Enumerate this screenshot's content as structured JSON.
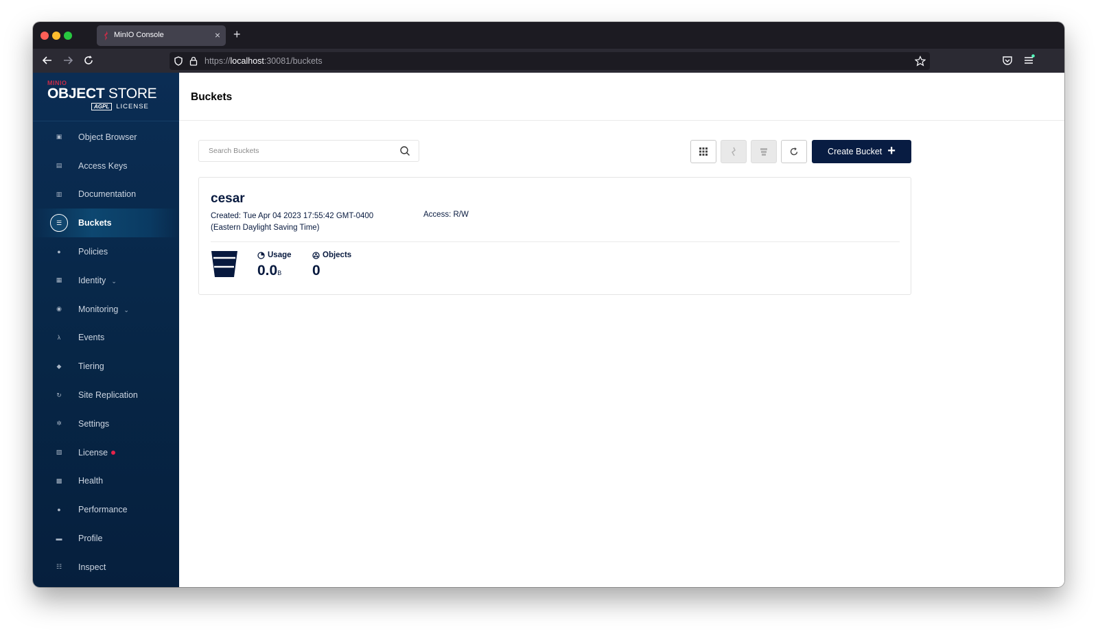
{
  "browser": {
    "tab_title": "MinIO Console",
    "tab_close": "×",
    "new_tab": "+",
    "url_scheme": "https://",
    "url_host": "localhost",
    "url_rest": ":30081/buckets"
  },
  "sidebar": {
    "logo_brand": "MINIO",
    "logo_bold": "OBJECT",
    "logo_light": " STORE",
    "logo_license_badge": "AGPL",
    "logo_license": "LICENSE",
    "items": [
      {
        "label": "Object Browser",
        "icon": "object-browser-icon"
      },
      {
        "label": "Access Keys",
        "icon": "access-keys-icon"
      },
      {
        "label": "Documentation",
        "icon": "documentation-icon"
      },
      {
        "label": "Buckets",
        "icon": "buckets-icon",
        "active": true
      },
      {
        "label": "Policies",
        "icon": "policies-icon"
      },
      {
        "label": "Identity",
        "icon": "identity-icon",
        "expandable": true
      },
      {
        "label": "Monitoring",
        "icon": "monitoring-icon",
        "expandable": true
      },
      {
        "label": "Events",
        "icon": "lambda-icon"
      },
      {
        "label": "Tiering",
        "icon": "tiering-icon"
      },
      {
        "label": "Site Replication",
        "icon": "site-replication-icon"
      },
      {
        "label": "Settings",
        "icon": "settings-icon"
      },
      {
        "label": "License",
        "icon": "license-icon",
        "alert_dot": true
      },
      {
        "label": "Health",
        "icon": "health-icon"
      },
      {
        "label": "Performance",
        "icon": "performance-icon"
      },
      {
        "label": "Profile",
        "icon": "profile-icon"
      },
      {
        "label": "Inspect",
        "icon": "inspect-icon"
      }
    ]
  },
  "main": {
    "title": "Buckets",
    "search_placeholder": "Search Buckets",
    "create_button": "Create Bucket",
    "create_plus": "+",
    "bucket": {
      "name": "cesar",
      "created_line1": "Created: Tue Apr 04 2023 17:55:42 GMT-0400",
      "created_line2": "(Eastern Daylight Saving Time)",
      "access": "Access: R/W",
      "usage_label": "Usage",
      "usage_value": "0.0",
      "usage_unit": "B",
      "objects_label": "Objects",
      "objects_value": "0"
    }
  },
  "colors": {
    "sidebar_bg": "#072646",
    "accent_navy": "#081c42",
    "license_dot": "#e6234a",
    "text_dark": "#07193e"
  }
}
